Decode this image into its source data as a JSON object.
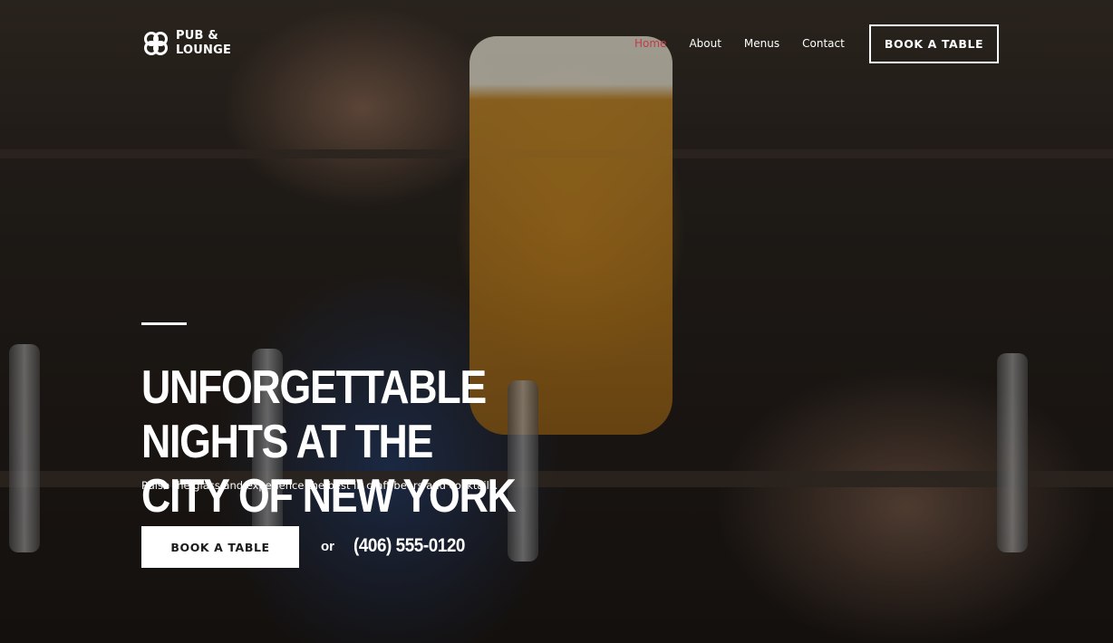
{
  "brand": {
    "line1": "PUB &",
    "line2": "LOUNGE",
    "logo_icon": "clover-logo-icon"
  },
  "nav": {
    "items": [
      {
        "label": "Home",
        "active": true
      },
      {
        "label": "About",
        "active": false
      },
      {
        "label": "Menus",
        "active": false
      },
      {
        "label": "Contact",
        "active": false
      }
    ],
    "cta_label": "BOOK A TABLE"
  },
  "hero": {
    "headline_line1": "UNFORGETTABLE NIGHTS AT THE",
    "headline_line2": "CITY OF NEW YORK",
    "subtext": "Raise the glass and experience the best in craft beers and cocktails.",
    "cta_label": "BOOK A TABLE",
    "or_text": "or",
    "phone": "(406) 555-0120"
  },
  "colors": {
    "active_nav": "#c53a4a",
    "text": "#ffffff",
    "button_bg": "#ffffff",
    "button_text": "#1b1b1b"
  }
}
